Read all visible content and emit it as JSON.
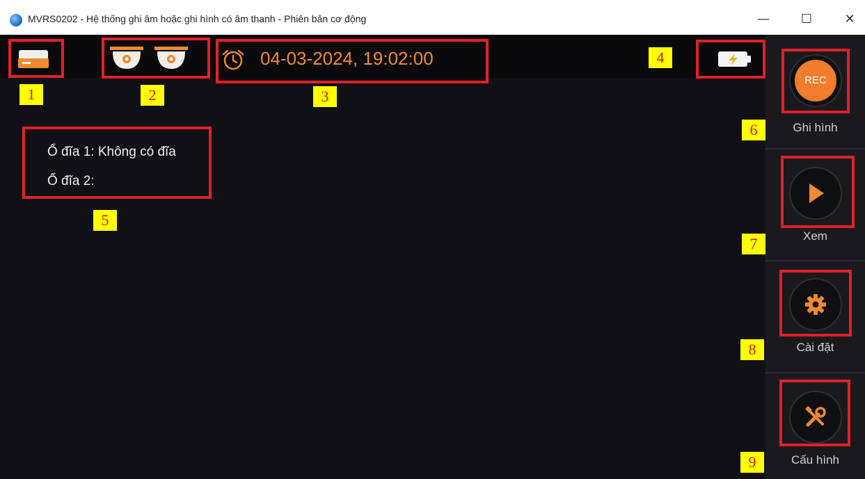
{
  "window": {
    "title": "MVRS0202 - Hệ thống ghi âm hoặc ghi hình có âm thanh - Phiên bản cơ động",
    "minimize": "—",
    "maximize": "☐",
    "close": "✕"
  },
  "topbar": {
    "datetime": "04-03-2024, 19:02:00",
    "icons": [
      "disk-drive-icon",
      "camera-icon",
      "camera-icon",
      "alarm-clock-icon",
      "battery-charging-icon"
    ]
  },
  "disks": {
    "disk1": "Ổ đĩa 1: Không có đĩa",
    "disk2": "Ổ đĩa 2:"
  },
  "sidebar": {
    "record": {
      "icon_text": "REC",
      "label": "Ghi hình"
    },
    "view": {
      "label": "Xem"
    },
    "settings": {
      "label": "Cài đặt"
    },
    "config": {
      "label": "Cấu hình"
    }
  },
  "annotations": [
    "1",
    "2",
    "3",
    "4",
    "5",
    "6",
    "7",
    "8",
    "9"
  ],
  "colors": {
    "accent": "#f08a30",
    "background": "#111115",
    "highlight_box": "#e0202a",
    "label_bg": "#ffff00"
  }
}
